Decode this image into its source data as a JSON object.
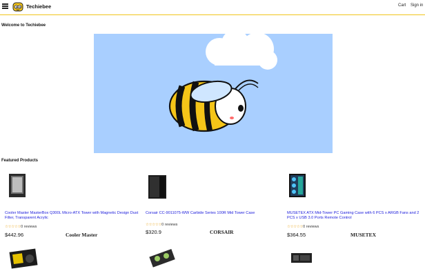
{
  "header": {
    "brand": "Techiebee",
    "cart_label": "Cart",
    "signin_label": "Sign in"
  },
  "main": {
    "welcome": "Welcome to Techiebee",
    "featured_heading": "Featured Products"
  },
  "products": [
    {
      "title": "Cooler Master MasterBox Q300L Micro-ATX Tower with Magnetic Design Dust Filter, Transparent Acrylic",
      "stars": "☆☆☆☆☆",
      "reviews": "0 reviews",
      "price": "$442.96",
      "brand": "Cooler Master"
    },
    {
      "title": "Corsair CC-9011075-WW Carbide Series 100R Mid Tower Case",
      "stars": "☆☆☆☆☆",
      "reviews": "0 reviews",
      "price": "$320.9",
      "brand": "CORSAIR"
    },
    {
      "title": "MUSETEX ATX Mid-Tower PC Gaming Case with 6 PCS x ARGB Fans and 2 PCS x USB 3.0 Ports Remote Control",
      "stars": "☆☆☆☆☆",
      "reviews": "0 reviews",
      "price": "$364.55",
      "brand": "MUSETEX"
    }
  ],
  "colors": {
    "accent": "#f0c419",
    "link": "#1a1adb",
    "hero_bg": "#a9cfff",
    "star": "#e8a317"
  }
}
